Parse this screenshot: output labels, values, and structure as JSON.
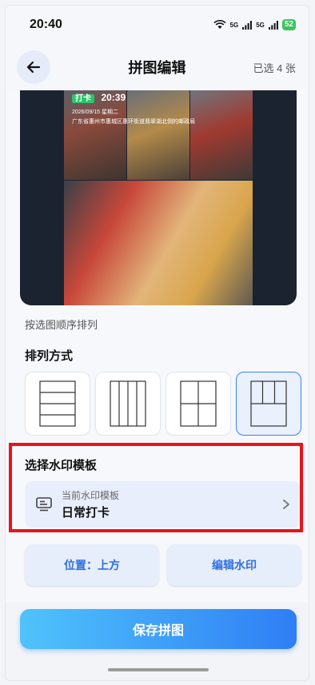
{
  "status_bar": {
    "time": "20:40",
    "network_1": "5G",
    "network_2": "5G",
    "battery": "52"
  },
  "header": {
    "title": "拼图编辑",
    "selected_count": "已选 4 张",
    "back_icon": "arrow-left-icon"
  },
  "preview": {
    "watermark_tag": "打卡",
    "watermark_time": "20:39",
    "watermark_date": "2026/09/15 星期二",
    "watermark_address": "广东省惠州市惠城区惠环街道翡翠湖北侧的邮政局"
  },
  "order_hint": "按选图顺序排列",
  "layout_section": {
    "title": "排列方式",
    "options": [
      {
        "name": "horizontal-rows",
        "selected": false
      },
      {
        "name": "vertical-columns",
        "selected": false
      },
      {
        "name": "grid-2x2",
        "selected": false
      },
      {
        "name": "three-top-one-bottom",
        "selected": true
      }
    ]
  },
  "watermark_section": {
    "title": "选择水印模板",
    "current_label": "当前水印模板",
    "current_name": "日常打卡",
    "icon": "monitor-icon"
  },
  "buttons": {
    "position": "位置：上方",
    "edit_watermark": "编辑水印",
    "save": "保存拼图"
  },
  "colors": {
    "accent": "#2f7ef5",
    "highlight": "#e8131b",
    "watermark_tag": "#2ec46b"
  }
}
